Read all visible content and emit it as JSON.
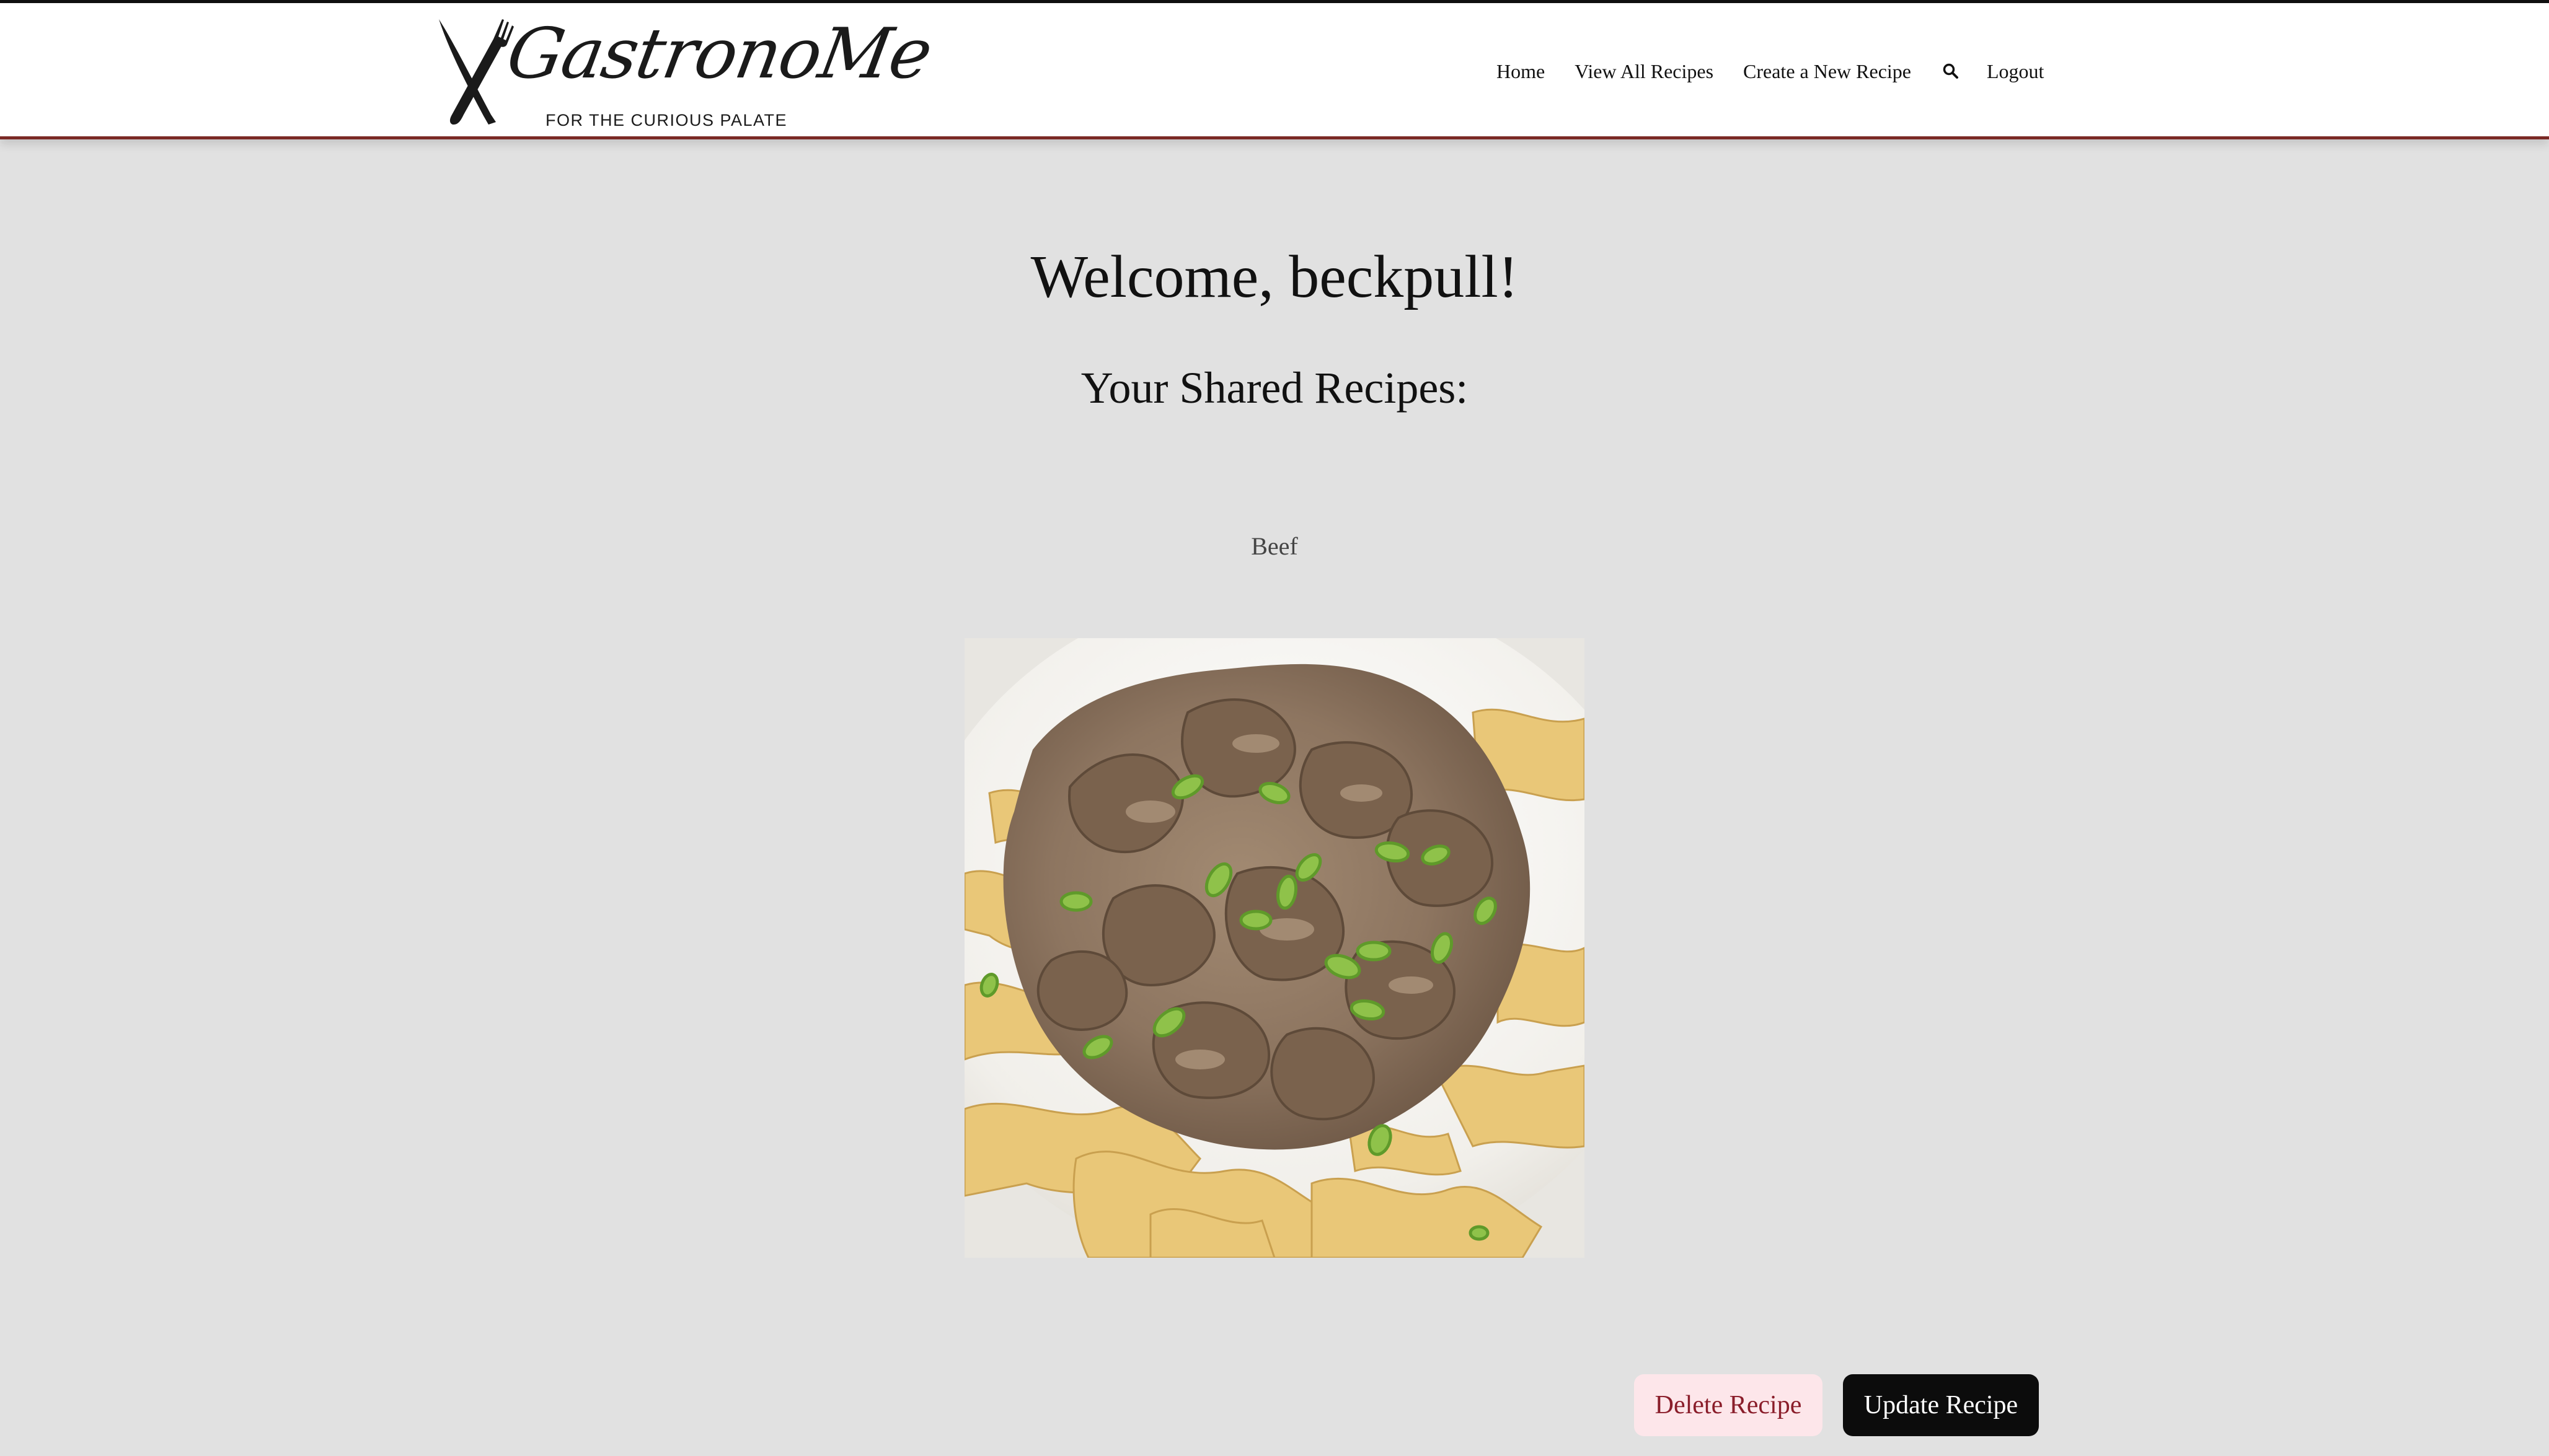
{
  "header": {
    "brand_name": "GastronoMe",
    "brand_tagline": "FOR THE CURIOUS PALATE",
    "nav": {
      "home": "Home",
      "view_all": "View All Recipes",
      "create": "Create a New Recipe",
      "search_icon": "search-icon",
      "logout": "Logout"
    },
    "accent_color": "#7b2a26"
  },
  "main": {
    "welcome": "Welcome, beckpull!",
    "shared_heading": "Your Shared Recipes:",
    "recipes": [
      {
        "title": "Beef",
        "image": "beef stroganoff over egg noodles with green onions",
        "delete_label": "Delete Recipe",
        "update_label": "Update Recipe"
      }
    ]
  },
  "colors": {
    "background": "#e1e1e1",
    "delete_bg": "#fde6ea",
    "delete_text": "#8a1d2a",
    "update_bg": "#0c0c0c"
  }
}
